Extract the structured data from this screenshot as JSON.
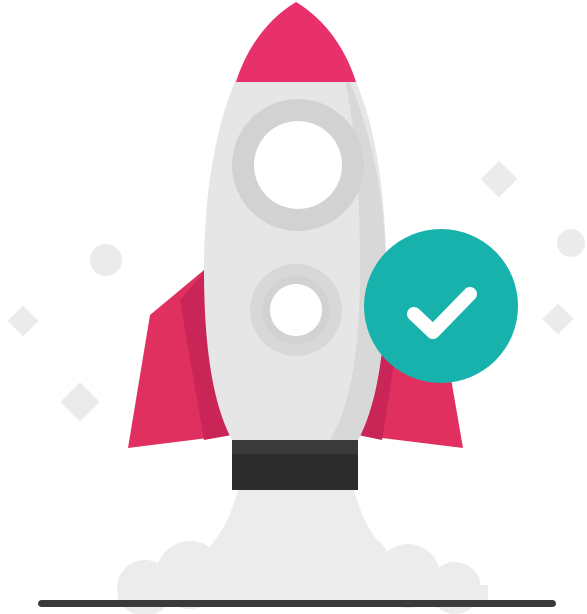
{
  "illustration": {
    "subject": "rocket-launch-success",
    "icons": [
      "rocket-icon",
      "checkmark-icon"
    ],
    "colors": {
      "nose": "#E8306A",
      "fin": "#E0305F",
      "fin_shade": "#C92556",
      "body": "#E6E6E6",
      "body_shade": "#D8D8D8",
      "window_ring": "#D2D2D2",
      "window": "#FFFFFF",
      "nozzle_band": "#2C2C2C",
      "smoke": "#ECECEC",
      "decor": "#EBEBEB",
      "badge": "#16B2AB",
      "ground": "#3A3A3A"
    }
  }
}
